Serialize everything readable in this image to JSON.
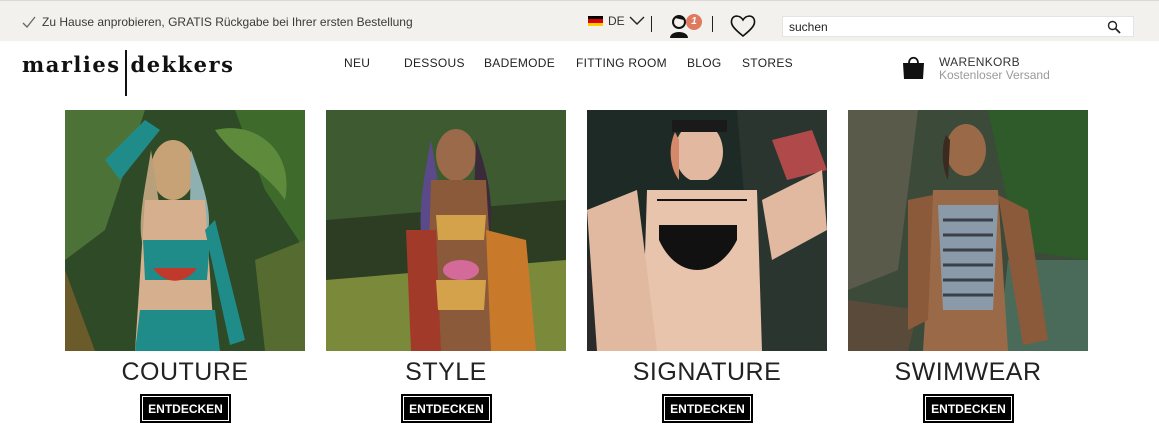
{
  "topbar": {
    "promo_text": "Zu Hause anprobieren, GRATIS Rückgabe bei Ihrer ersten Bestellung",
    "promo_icon": "check-icon",
    "language": "DE",
    "account_badge": "1",
    "search": {
      "placeholder": "suchen",
      "value": ""
    }
  },
  "header": {
    "logo_left": "marlies",
    "logo_right": "dekkers",
    "nav": [
      "NEU",
      "DESSOUS",
      "BADEMODE",
      "FITTING ROOM",
      "BLOG",
      "STORES"
    ],
    "cart": {
      "title": "WARENKORB",
      "subtitle": "Kostenloser Versand"
    }
  },
  "tiles": [
    {
      "title": "COUTURE",
      "button": "ENTDECKEN"
    },
    {
      "title": "STYLE",
      "button": "ENTDECKEN"
    },
    {
      "title": "SIGNATURE",
      "button": "ENTDECKEN"
    },
    {
      "title": "SWIMWEAR",
      "button": "ENTDECKEN"
    }
  ],
  "colors": {
    "topbar_bg": "#f2f1ee",
    "badge": "#e07a5f",
    "button_bg": "#000000",
    "button_text": "#ffffff"
  }
}
